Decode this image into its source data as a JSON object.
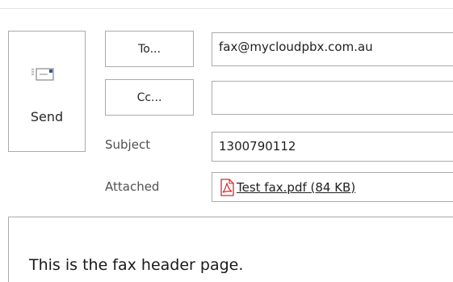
{
  "compose": {
    "send_label": "Send",
    "to_button_label": "To...",
    "cc_button_label": "Cc...",
    "to_value": "fax@mycloudpbx.com.au",
    "cc_value": "",
    "subject_label": "Subject",
    "subject_value": "1300790112",
    "attached_label": "Attached",
    "attachment_name": "Test fax.pdf (84 KB)",
    "body_text": "This is the fax header page."
  },
  "icons": {
    "send": "send-envelope-icon",
    "attachment": "pdf-file-icon"
  },
  "colors": {
    "border": "#ababab",
    "pdf_red": "#d42b2b",
    "send_icon_blue": "#2b579a"
  }
}
